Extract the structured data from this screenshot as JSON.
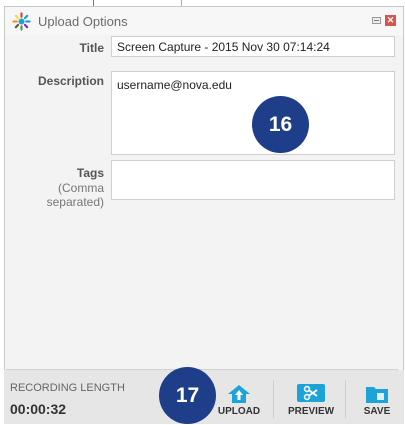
{
  "window": {
    "title": "Upload Options"
  },
  "form": {
    "title_label": "Title",
    "title_value": "Screen Capture - 2015 Nov 30 07:14:24",
    "description_label": "Description",
    "description_value": "username@nova.edu",
    "tags_label": "Tags",
    "tags_hint_1": "(Comma",
    "tags_hint_2": "separated)",
    "tags_value": ""
  },
  "annotations": {
    "badge_description": "16",
    "badge_upload": "17"
  },
  "footer": {
    "recording_label": "RECORDING LENGTH",
    "recording_time": "00:00:32",
    "upload_label": "UPLOAD",
    "preview_label": "PREVIEW",
    "save_label": "SAVE"
  },
  "icons": {
    "app": "upload-options-icon",
    "minimize": "minimize-icon",
    "close": "close-icon",
    "upload": "upload-home-icon",
    "preview": "scissors-icon",
    "save": "folder-save-icon"
  },
  "colors": {
    "accent": "#1ea3d8",
    "badge": "#1e3e8a",
    "close": "#d9534f"
  }
}
